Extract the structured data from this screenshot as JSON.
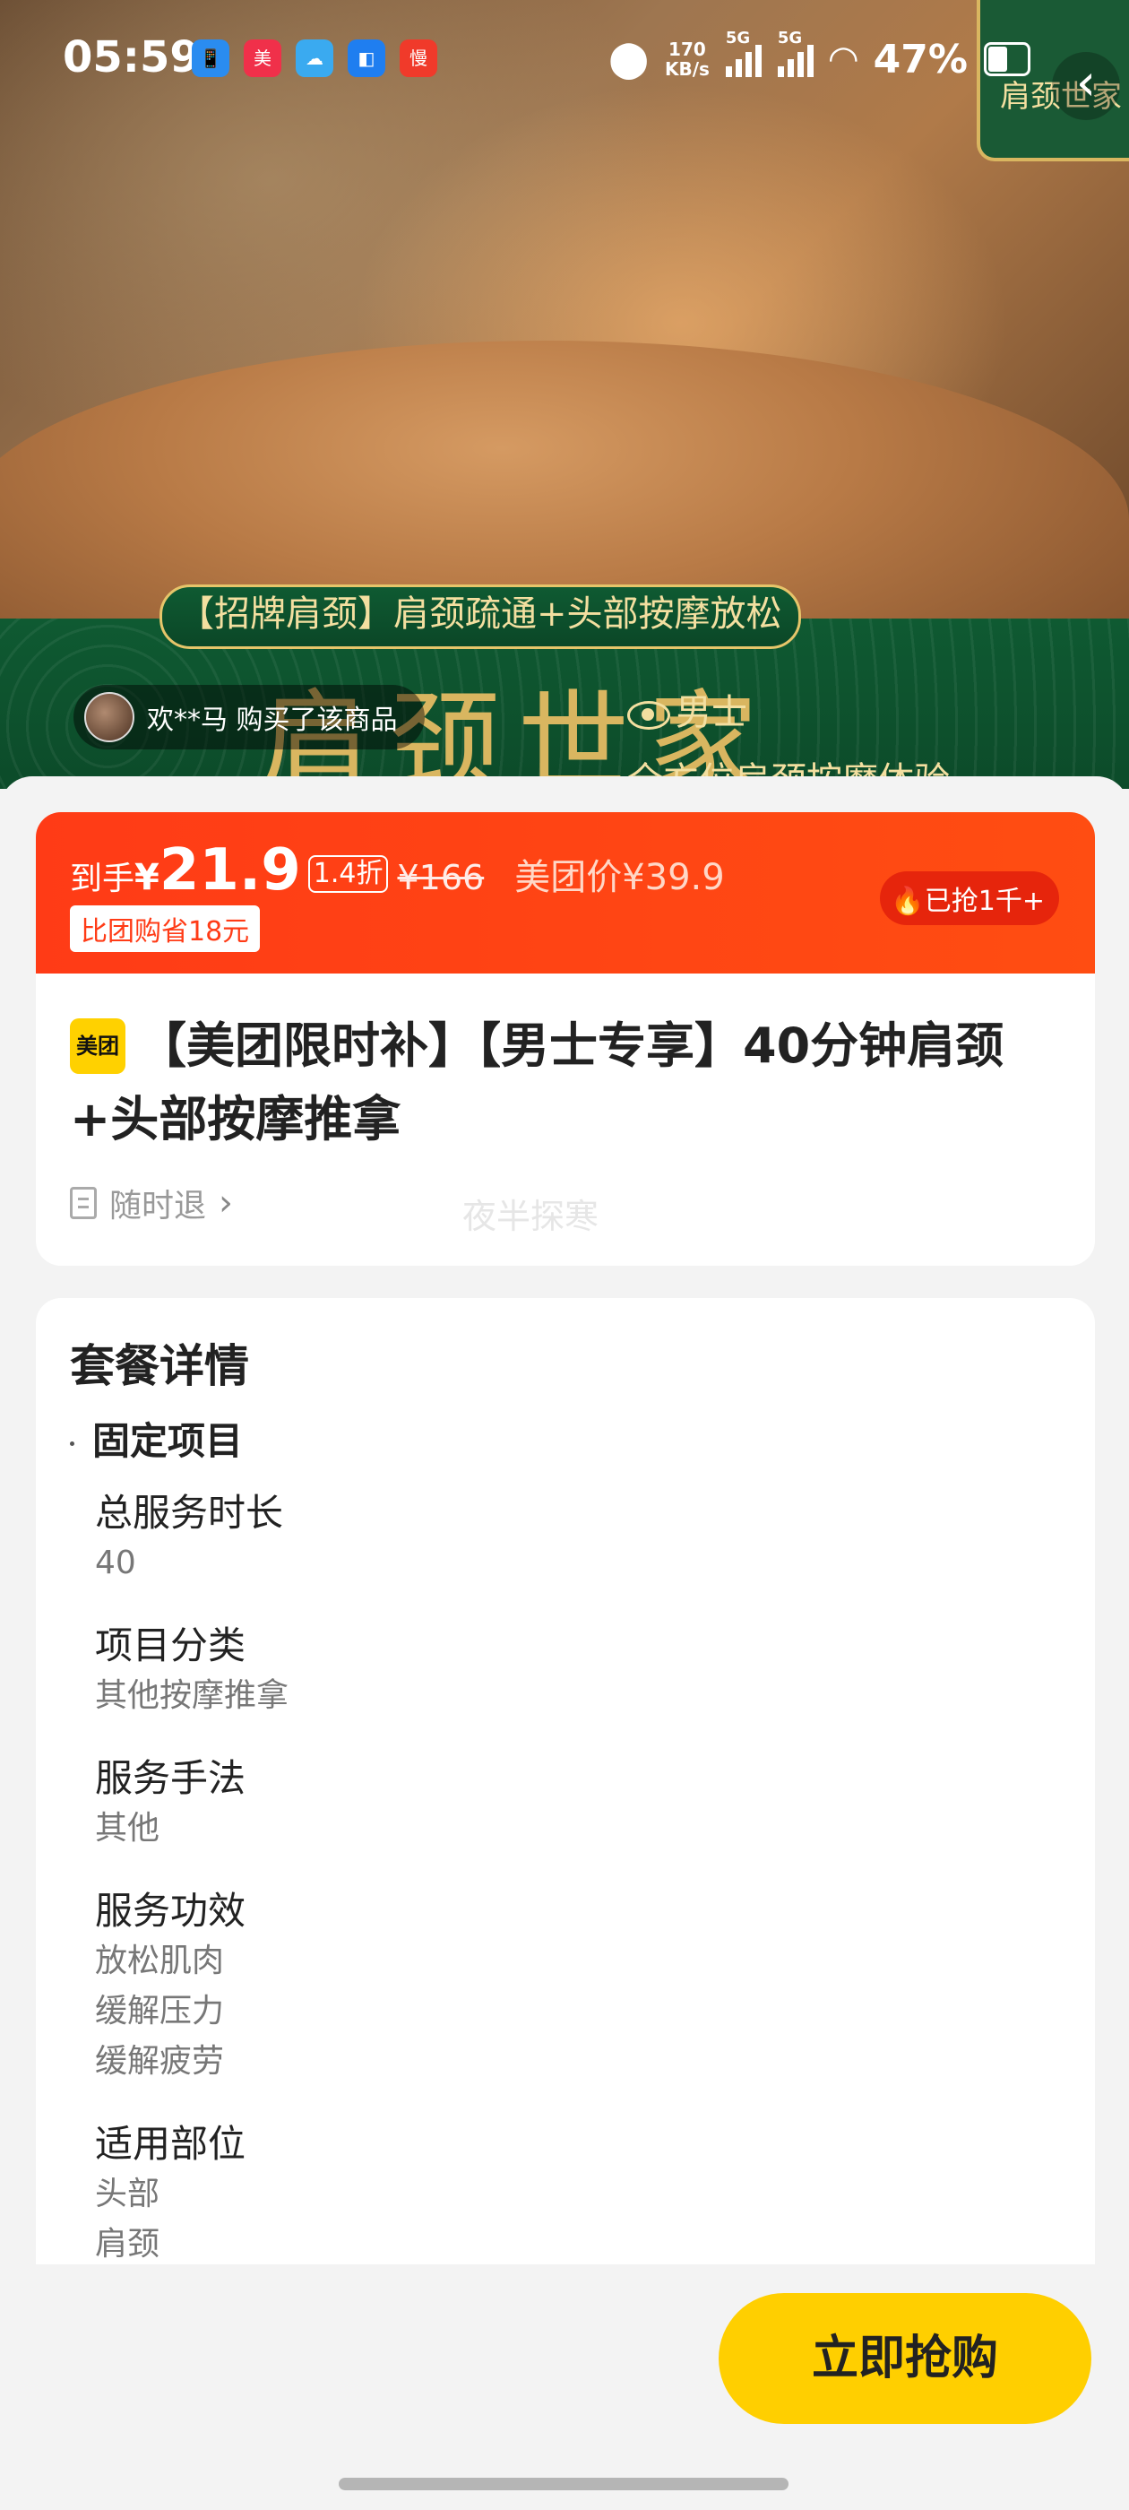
{
  "status_bar": {
    "time": "05:59",
    "net_speed_value": "170",
    "net_speed_unit": "KB/s",
    "sim1_label": "5G",
    "sim2_label": "5G",
    "battery": "47%",
    "notification_icons": [
      {
        "name": "phone-app-icon",
        "color": "#2a8cf0",
        "text": "📱"
      },
      {
        "name": "meituan-waimai-icon",
        "color": "#f0304a",
        "text": "美"
      },
      {
        "name": "cloud-ai-icon",
        "color": "#3aaaf0",
        "text": "☁"
      },
      {
        "name": "blue-app-icon",
        "color": "#1f7ef0",
        "text": "◧"
      },
      {
        "name": "man-app-icon",
        "color": "#f03a2a",
        "text": "慢"
      }
    ]
  },
  "hero": {
    "slogan": "【招牌肩颈】肩颈疏通+头部按摩放松",
    "brand_big": "肩颈世家",
    "male_tag": "男士",
    "sub_slogan": "全方位肩颈按摩体验",
    "corner_logo": "肩颈世家",
    "buyer_ticker": "欢**马 购买了该商品"
  },
  "price": {
    "label": "到手",
    "currency": "¥",
    "amount": "21.9",
    "discount": "1.4折",
    "original": "¥166",
    "meituan_price": "美团价¥39.9",
    "save_tag": "比团购省18元",
    "sold": "🔥已抢1千+"
  },
  "product": {
    "logo_text": "美团",
    "title": "【美团限时补】【男士专享】40分钟肩颈+头部按摩推拿",
    "refund": "随时退",
    "watermark": "夜半探寒"
  },
  "details": {
    "heading": "套餐详情",
    "group": "固定项目",
    "items": [
      {
        "key": "总服务时长",
        "values": [
          "40"
        ]
      },
      {
        "key": "项目分类",
        "values": [
          "其他按摩推拿"
        ]
      },
      {
        "key": "服务手法",
        "values": [
          "其他"
        ]
      },
      {
        "key": "服务功效",
        "values": [
          "放松肌肉",
          "缓解压力",
          "缓解疲劳"
        ]
      },
      {
        "key": "适用部位",
        "values": [
          "头部",
          "肩颈"
        ]
      }
    ]
  },
  "bottom": {
    "buy_label": "立即抢购"
  },
  "colors": {
    "accent_red": "#ff3b16",
    "buy_yellow": "#ffcf00",
    "hero_green": "#0f5a32",
    "gold": "#d9b660"
  }
}
